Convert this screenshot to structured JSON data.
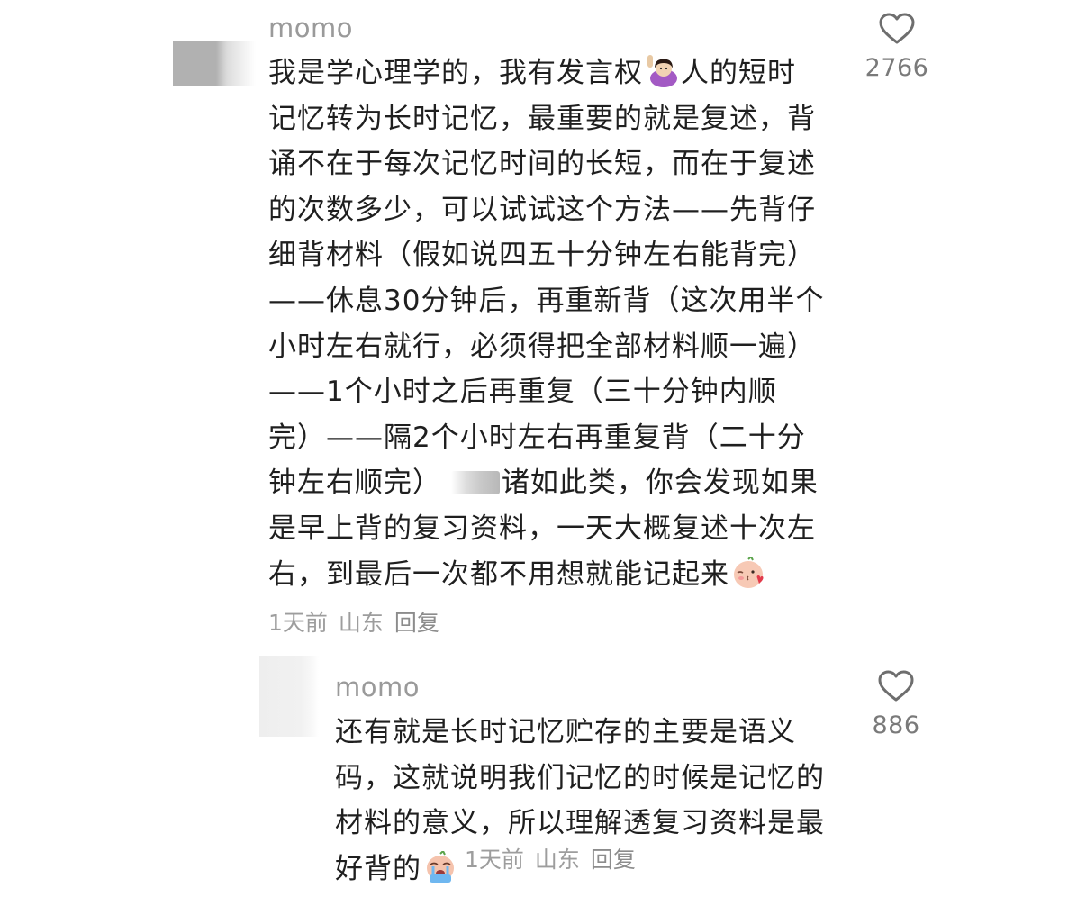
{
  "comment": {
    "username": "momo",
    "lines": [
      "我是学心理学的，我有发言权",
      "人的短时",
      "记忆转为长时记忆，最重要的就是复述，背",
      "诵不在于每次记忆时间的长短，而在于复述",
      "的次数多少，可以试试这个方法——先背仔",
      "细背材料（假如说四五十分钟左右能背完）",
      "——休息30分钟后，再重新背（这次用半个",
      "小时左右就行，必须得把全部材料顺一遍）",
      "——1个小时之后再重复（三十分钟内顺",
      "完）——隔2个小时左右再重复背（二十分",
      "钟左右顺完）",
      "诸如此类，你会发现如果",
      "是早上背的复习资料，一天大概复述十次左",
      "右，到最后一次都不用想就能记起来"
    ],
    "time": "1天前",
    "location": "山东",
    "reply_label": "回复",
    "likes": "2766"
  },
  "reply": {
    "username": "momo",
    "lines": [
      "还有就是长时记忆贮存的主要是语义",
      "码，这就说明我们记忆的时候是记忆的",
      "材料的意义，所以理解透复习资料是最",
      "好背的"
    ],
    "time": "1天前",
    "location": "山东",
    "reply_label": "回复",
    "likes": "886"
  },
  "icons": {
    "like": "heart-outline-icon",
    "emoji_1": "person-raising-hand-emoji",
    "emoji_2": "blushing-kiss-emoji",
    "emoji_3": "crying-face-emoji"
  },
  "colors": {
    "username": "#9a9a9a",
    "text": "#1f1f1f",
    "meta": "#9d9d9d",
    "like_count": "#7a7a7a"
  }
}
